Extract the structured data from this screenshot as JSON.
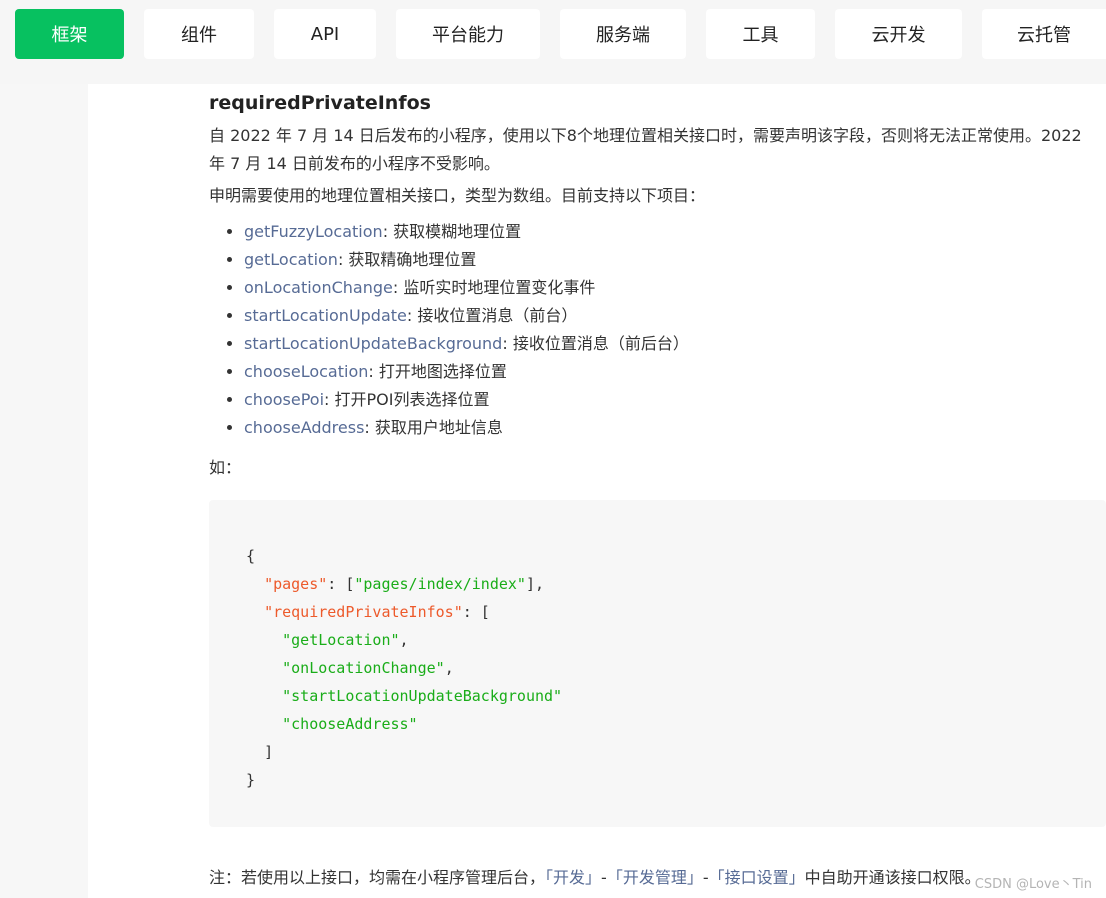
{
  "nav": {
    "tabs": [
      {
        "label": "框架",
        "active": true
      },
      {
        "label": "组件",
        "active": false
      },
      {
        "label": "API",
        "active": false
      },
      {
        "label": "平台能力",
        "active": false
      },
      {
        "label": "服务端",
        "active": false
      },
      {
        "label": "工具",
        "active": false
      },
      {
        "label": "云开发",
        "active": false
      },
      {
        "label": "云托管",
        "active": false
      }
    ]
  },
  "doc": {
    "heading": "requiredPrivateInfos",
    "intro": "自 2022 年 7 月 14 日后发布的小程序，使用以下8个地理位置相关接口时，需要声明该字段，否则将无法正常使用。2022 年 7 月 14 日前发布的小程序不受影响。",
    "declare": "申明需要使用的地理位置相关接口，类型为数组。目前支持以下项目：",
    "apis": [
      {
        "name": "getFuzzyLocation",
        "desc": ": 获取模糊地理位置"
      },
      {
        "name": "getLocation",
        "desc": ": 获取精确地理位置"
      },
      {
        "name": "onLocationChange",
        "desc": ": 监听实时地理位置变化事件"
      },
      {
        "name": "startLocationUpdate",
        "desc": ": 接收位置消息（前台）"
      },
      {
        "name": "startLocationUpdateBackground",
        "desc": ": 接收位置消息（前后台）"
      },
      {
        "name": "chooseLocation",
        "desc": ": 打开地图选择位置"
      },
      {
        "name": "choosePoi",
        "desc": ": 打开POI列表选择位置"
      },
      {
        "name": "chooseAddress",
        "desc": ": 获取用户地址信息"
      }
    ],
    "example_label": "如：",
    "code": {
      "open": "{",
      "pages_key": "\"pages\"",
      "pages_sep": ": [",
      "pages_val": "\"pages/index/index\"",
      "pages_end": "],",
      "rpi_key": "\"requiredPrivateInfos\"",
      "rpi_sep": ": [",
      "items": [
        "\"getLocation\"",
        "\"onLocationChange\"",
        "\"startLocationUpdateBackground\"",
        "\"chooseAddress\""
      ],
      "comma": ",",
      "close_arr": "]",
      "close": "}"
    },
    "note": {
      "prefix": "注：若使用以上接口，均需在小程序管理后台，",
      "link1": "「开发」",
      "sep1": "-",
      "link2": "「开发管理」",
      "sep2": "-",
      "link3": "「接口设置」",
      "suffix": "中自助开通该接口权限。"
    },
    "watermark": "CSDN @Love丶Tin"
  }
}
